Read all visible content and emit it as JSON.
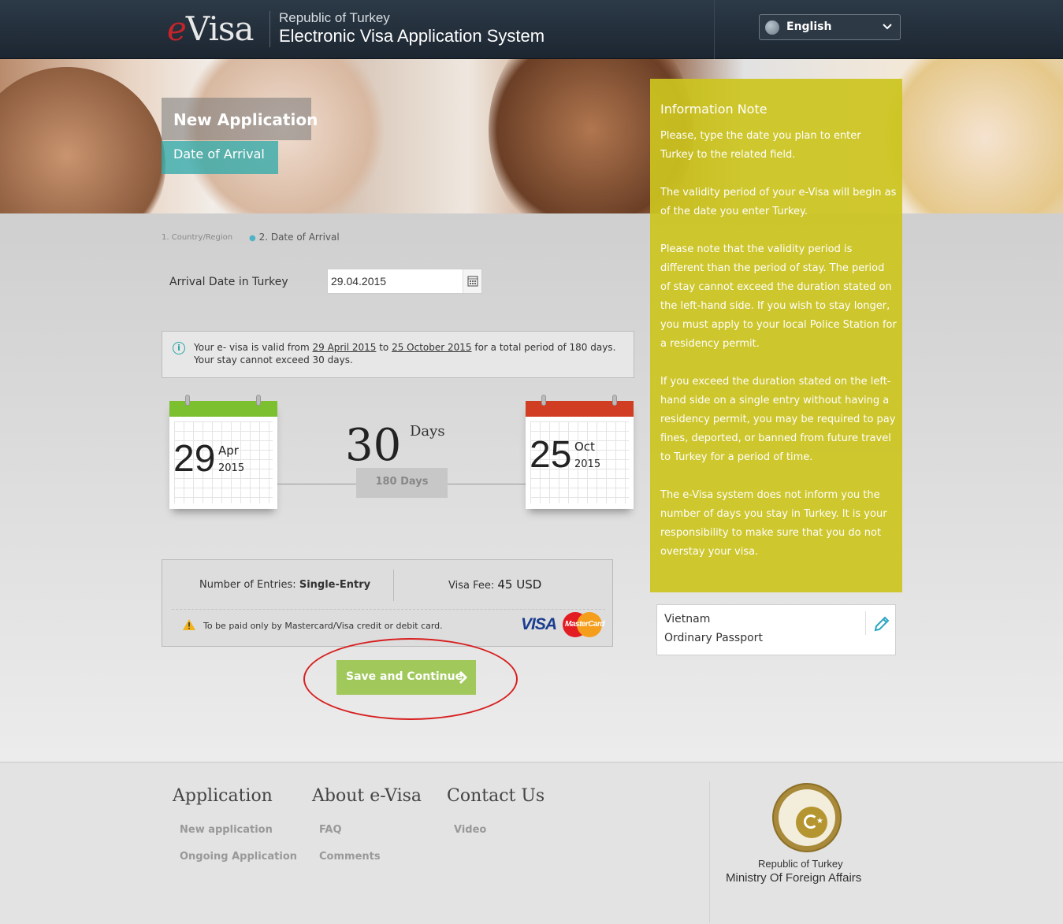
{
  "header": {
    "logo_prefix": "e",
    "logo_main": "Visa",
    "title_small": "Republic of Turkey",
    "title_big": "Electronic Visa Application System",
    "language": "English"
  },
  "banner": {
    "tag": "New Application",
    "subtag": "Date of Arrival"
  },
  "breadcrumb": {
    "step1": "1. Country/Region",
    "step2": "2. Date of Arrival"
  },
  "arrival": {
    "label": "Arrival Date in Turkey",
    "value": "29.04.2015"
  },
  "validity": {
    "text_a": "Your e- visa is valid from ",
    "from": "29 April 2015",
    "text_b": " to ",
    "to": "25 October 2015",
    "text_c": " for a total period of 180 days. Your stay cannot exceed 30 days."
  },
  "calendar_start": {
    "day": "29",
    "month": "Apr",
    "year": "2015",
    "color": "#7cbf2f"
  },
  "calendar_end": {
    "day": "25",
    "month": "Oct",
    "year": "2015",
    "color": "#d13d22"
  },
  "stay": {
    "number": "30",
    "unit": "Days",
    "total": "180 Days"
  },
  "fee_box": {
    "entries_label": "Number of Entries:",
    "entries_value": "Single-Entry",
    "fee_label": "Visa Fee:",
    "fee_value": "45 USD",
    "payment_note": "To be paid only by Mastercard/Visa credit or debit card.",
    "visa_logo": "VISA",
    "mastercard_logo": "MasterCard"
  },
  "save_button": "Save and Continue",
  "info_note": {
    "title": "Information Note",
    "paragraphs": [
      "Please, type the date you plan to enter Turkey to the related field.",
      "The validity period of your e-Visa will begin as of the date you enter Turkey.",
      "Please note that the validity period is different than the period of stay. The period of stay cannot exceed the duration stated on the left-hand side. If you wish to stay longer, you must apply to your local Police Station for a residency permit.",
      "If you exceed the duration stated on the left-hand side on a single entry without having a residency permit, you may be required to pay fines, deported, or banned from future travel to Turkey for a period of time.",
      "The e-Visa system does not inform you the number of days you stay in Turkey. It is your responsibility to make sure that you do not overstay your visa."
    ]
  },
  "passport": {
    "country": "Vietnam",
    "type": "Ordinary Passport"
  },
  "footer": {
    "col1_title": "Application",
    "col1_links": [
      "New application",
      "Ongoing Application"
    ],
    "col2_title": "About e-Visa",
    "col2_links": [
      "FAQ",
      "Comments"
    ],
    "col3_title": "Contact Us",
    "col3_links": [
      "Video"
    ],
    "ministry_line1": "Republic of Turkey",
    "ministry_line2": "Ministry Of Foreign Affairs"
  }
}
